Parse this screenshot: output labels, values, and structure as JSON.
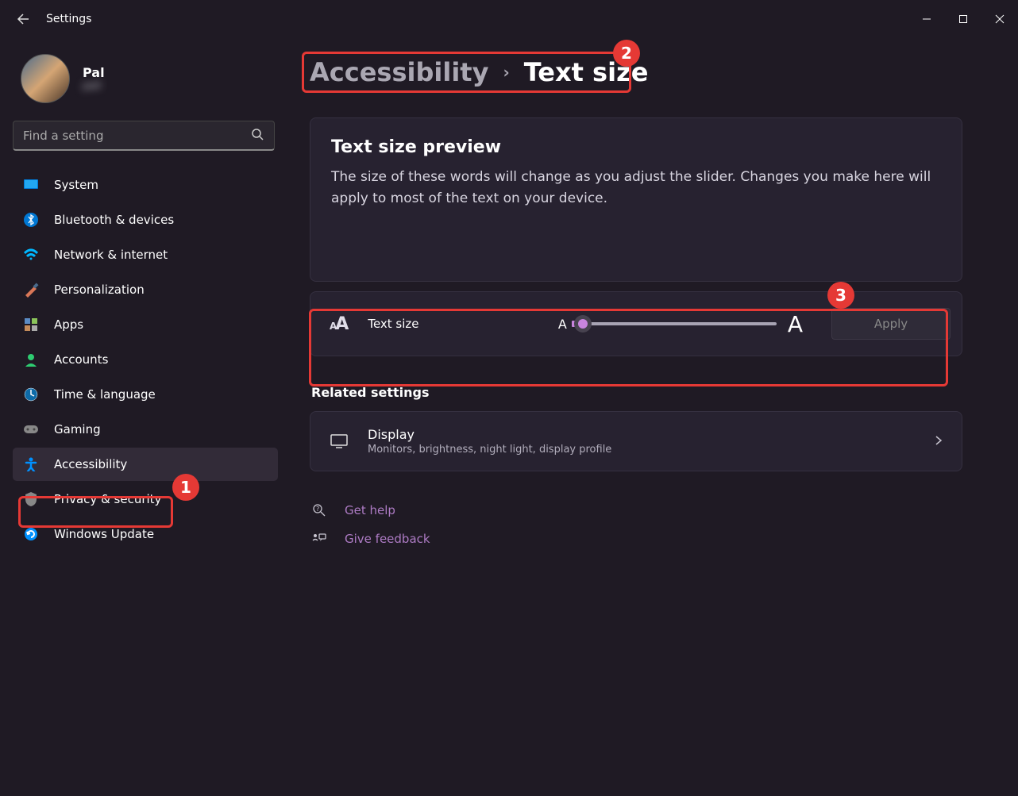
{
  "window": {
    "title": "Settings"
  },
  "user": {
    "name": "Pal",
    "email": "pall"
  },
  "search": {
    "placeholder": "Find a setting"
  },
  "nav": [
    {
      "label": "System"
    },
    {
      "label": "Bluetooth & devices"
    },
    {
      "label": "Network & internet"
    },
    {
      "label": "Personalization"
    },
    {
      "label": "Apps"
    },
    {
      "label": "Accounts"
    },
    {
      "label": "Time & language"
    },
    {
      "label": "Gaming"
    },
    {
      "label": "Accessibility"
    },
    {
      "label": "Privacy & security"
    },
    {
      "label": "Windows Update"
    }
  ],
  "breadcrumb": {
    "parent": "Accessibility",
    "current": "Text size"
  },
  "preview": {
    "title": "Text size preview",
    "desc": "The size of these words will change as you adjust the slider. Changes you make here will apply to most of the text on your device."
  },
  "slider": {
    "label": "Text size",
    "small": "A",
    "large": "A",
    "apply": "Apply"
  },
  "related": {
    "heading": "Related settings",
    "display": {
      "title": "Display",
      "desc": "Monitors, brightness, night light, display profile"
    }
  },
  "links": {
    "help": "Get help",
    "feedback": "Give feedback"
  },
  "markers": {
    "m1": "1",
    "m2": "2",
    "m3": "3"
  }
}
